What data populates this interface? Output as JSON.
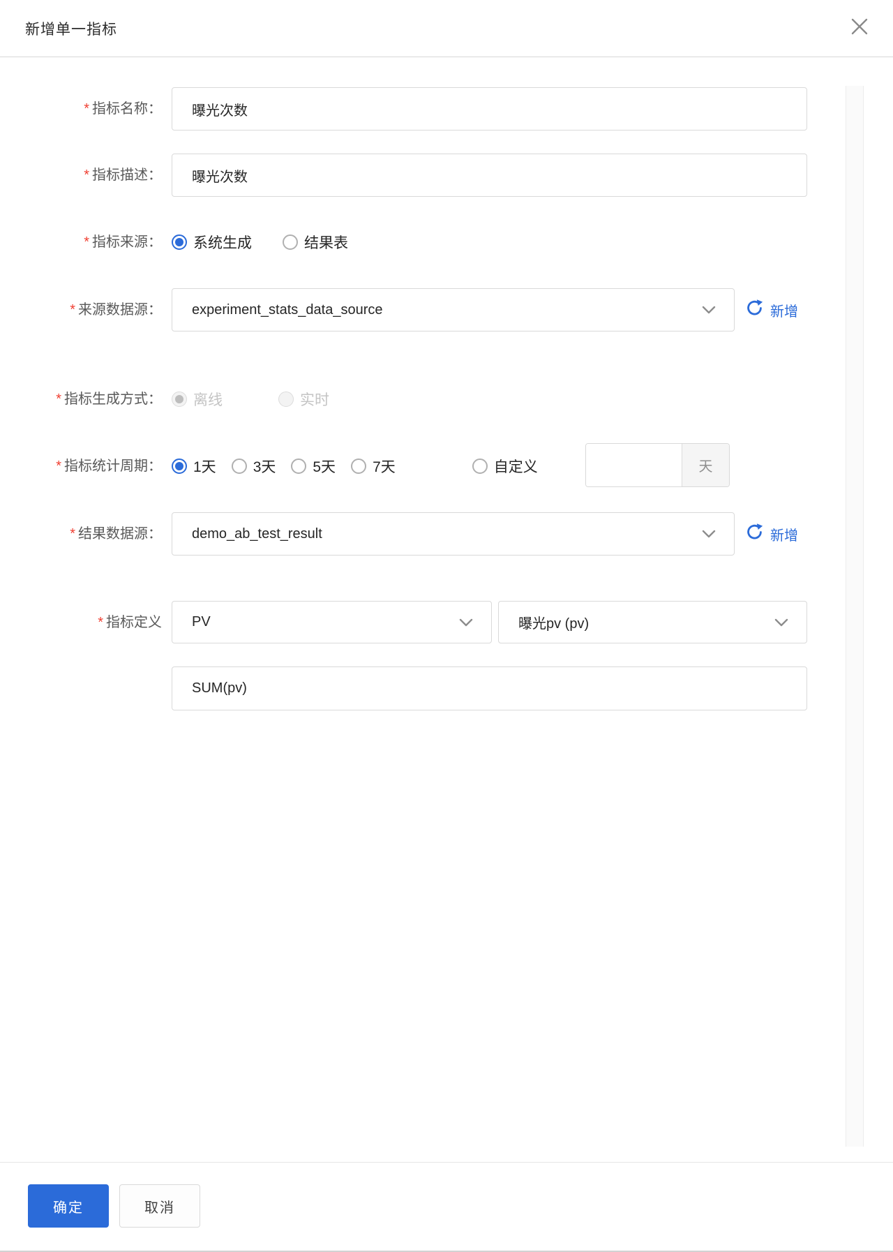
{
  "header": {
    "title": "新增单一指标"
  },
  "required_mark": "*",
  "fields": {
    "metric_name": {
      "label": "指标名称：",
      "value": "曝光次数"
    },
    "metric_desc": {
      "label": "指标描述：",
      "value": "曝光次数"
    },
    "metric_source": {
      "label": "指标来源：",
      "options": [
        {
          "label": "系统生成",
          "selected": true
        },
        {
          "label": "结果表",
          "selected": false
        }
      ]
    },
    "source_datasource": {
      "label": "来源数据源：",
      "value": "experiment_stats_data_source",
      "add_link": "新增"
    },
    "generation_mode": {
      "label": "指标生成方式：",
      "disabled": true,
      "options": [
        {
          "label": "离线",
          "selected": true
        },
        {
          "label": "实时",
          "selected": false
        }
      ]
    },
    "stat_period": {
      "label": "指标统计周期：",
      "options": [
        {
          "label": "1天",
          "selected": true
        },
        {
          "label": "3天",
          "selected": false
        },
        {
          "label": "5天",
          "selected": false
        },
        {
          "label": "7天",
          "selected": false
        },
        {
          "label": "自定义",
          "selected": false
        }
      ],
      "custom_value": "",
      "custom_unit": "天"
    },
    "result_datasource": {
      "label": "结果数据源：",
      "value": "demo_ab_test_result",
      "add_link": "新增"
    },
    "metric_definition": {
      "label": "指标定义",
      "type_value": "PV",
      "field_value": "曝光pv (pv)",
      "formula": "SUM(pv)"
    }
  },
  "footer": {
    "ok": "确定",
    "cancel": "取消"
  },
  "colors": {
    "primary": "#2b6bd9",
    "required": "#f04134",
    "link": "#2b6bd9"
  }
}
